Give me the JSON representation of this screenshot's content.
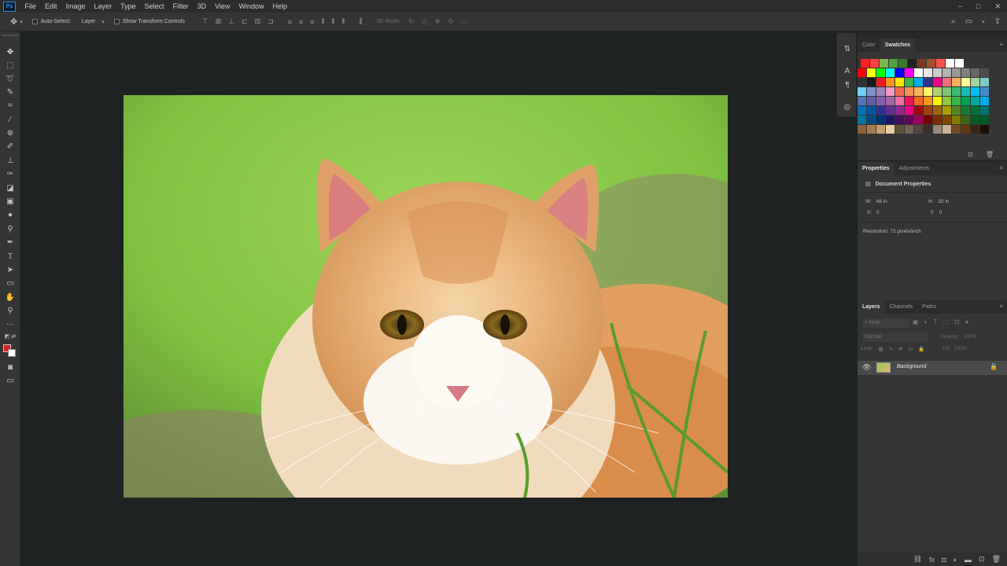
{
  "app": {
    "logo": "Ps"
  },
  "menu": [
    "File",
    "Edit",
    "Image",
    "Layer",
    "Type",
    "Select",
    "Filter",
    "3D",
    "View",
    "Window",
    "Help"
  ],
  "window_controls": [
    "−",
    "□",
    "✕"
  ],
  "options": {
    "auto_select_label": "Auto-Select:",
    "auto_select_value": "Layer",
    "show_transform_label": "Show Transform Controls",
    "mode_3d_label": "3D Mode:"
  },
  "swatches_panel": {
    "tabs": [
      "Color",
      "Swatches"
    ],
    "active_tab": "Swatches"
  },
  "properties_panel": {
    "tabs": [
      "Properties",
      "Adjustments"
    ],
    "active_tab": "Properties",
    "section_title": "Document Properties",
    "w_label": "W:",
    "w_value": "48 in",
    "h_label": "H:",
    "h_value": "32 in",
    "x_label": "X:",
    "x_value": "0",
    "y_label": "Y:",
    "y_value": "0",
    "resolution": "Resolution: 72 pixels/inch"
  },
  "layers_panel": {
    "tabs": [
      "Layers",
      "Channels",
      "Paths"
    ],
    "active_tab": "Layers",
    "filter_placeholder": "Kind",
    "blend_mode": "Normal",
    "opacity_label": "Opacity:",
    "opacity_value": "100%",
    "lock_label": "Lock:",
    "fill_label": "Fill:",
    "fill_value": "100%",
    "layers": [
      {
        "name": "Background",
        "visible": true,
        "locked": true
      }
    ]
  },
  "colors": {
    "foreground": "#e11c1c",
    "background": "#ffffff",
    "accent": "#2d8ee6"
  }
}
